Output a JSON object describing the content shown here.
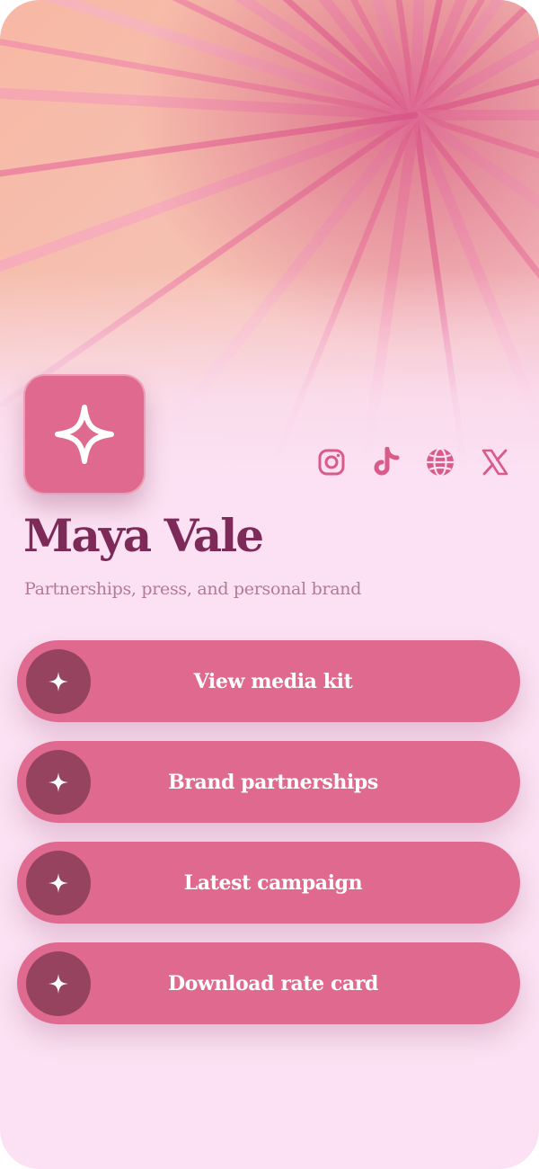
{
  "profile": {
    "name": "Maya Vale",
    "tagline": "Partnerships, press, and personal brand",
    "logo_icon": "sparkle-icon"
  },
  "socials": [
    {
      "icon": "instagram-icon"
    },
    {
      "icon": "tiktok-icon"
    },
    {
      "icon": "globe-icon"
    },
    {
      "icon": "x-icon"
    }
  ],
  "links": [
    {
      "label": "View media kit",
      "icon": "sparkle-icon"
    },
    {
      "label": "Brand partnerships",
      "icon": "sparkle-icon"
    },
    {
      "label": "Latest campaign",
      "icon": "sparkle-icon"
    },
    {
      "label": "Download rate card",
      "icon": "sparkle-icon"
    }
  ],
  "colors": {
    "accent": "#e06a8f",
    "accent_dark": "#964360",
    "name": "#7e2a58",
    "background": "#fbe1f3"
  }
}
